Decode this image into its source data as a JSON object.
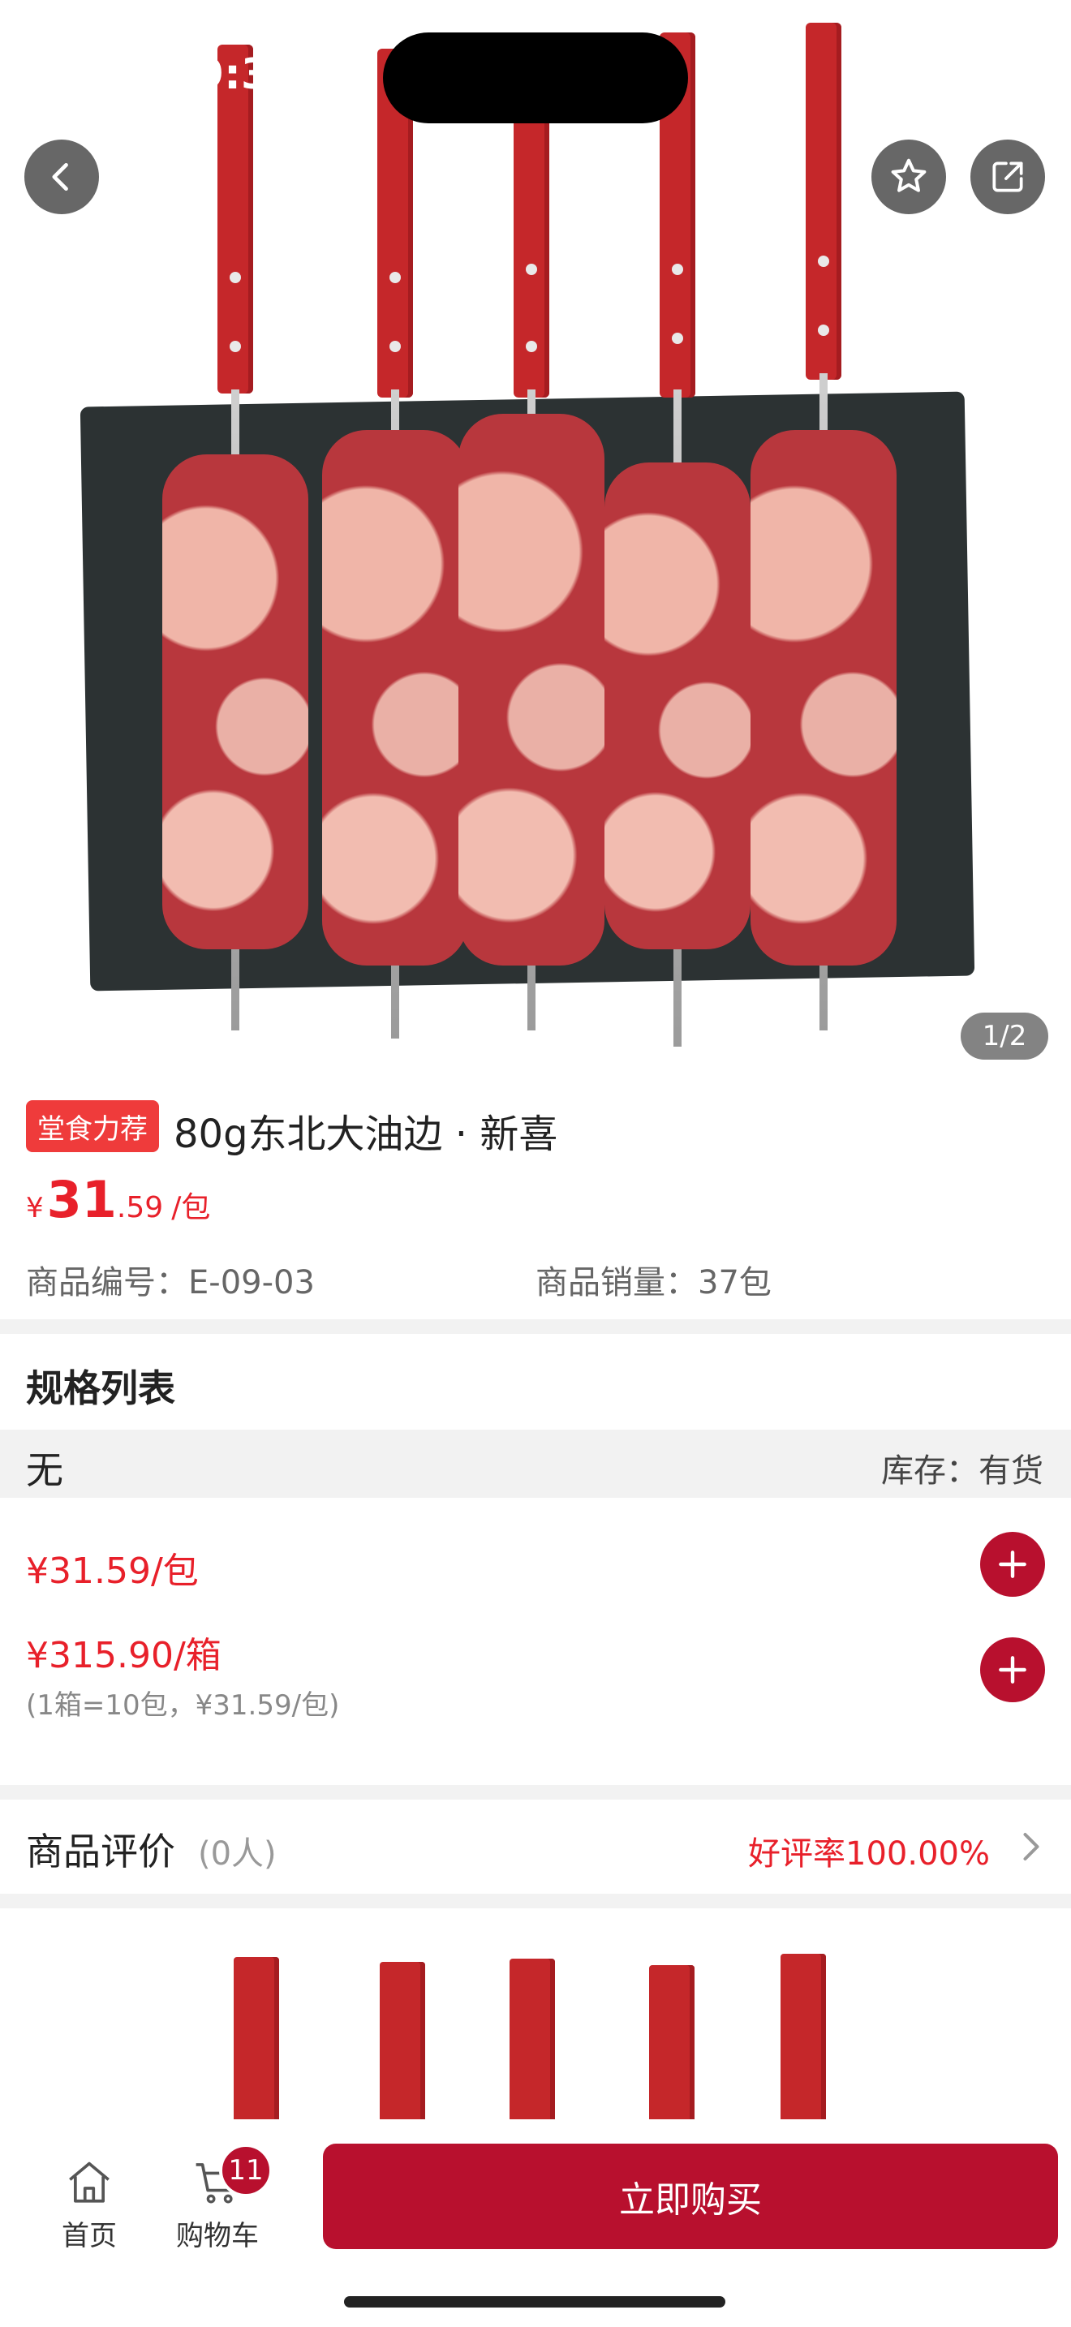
{
  "status_bar": {
    "time": "9:39"
  },
  "gallery": {
    "counter": "1/2"
  },
  "product": {
    "tag": "堂食力荐",
    "title": "80g东北大油边 · 新喜",
    "price_symbol": "¥",
    "price_int": "31",
    "price_dec": ".59",
    "price_unit": "/包",
    "code_label": "商品编号：",
    "code_value": "E-09-03",
    "sales_label": "商品销量：",
    "sales_value": "37包"
  },
  "spec": {
    "section_title": "规格列表",
    "name": "无",
    "stock_label": "库存：",
    "stock_value": "有货",
    "options": [
      {
        "price": "¥31.59",
        "unit": "/包",
        "note": ""
      },
      {
        "price": "¥315.90",
        "unit": "/箱",
        "note": "(1箱=10包，¥31.59/包)"
      }
    ]
  },
  "reviews": {
    "label": "商品评价",
    "count": "(0人)",
    "rate_label": "好评率",
    "rate_value": "100.00%"
  },
  "bottom_bar": {
    "home_label": "首页",
    "cart_label": "购物车",
    "cart_count": "11",
    "buy_label": "立即购买"
  },
  "colors": {
    "accent": "#b8102e",
    "price_red": "#e8202a",
    "tag_red": "#ef3b3b"
  },
  "icons": [
    "back-icon",
    "star-icon",
    "share-icon",
    "plus-icon",
    "chevron-right-icon",
    "home-icon",
    "cart-icon"
  ]
}
